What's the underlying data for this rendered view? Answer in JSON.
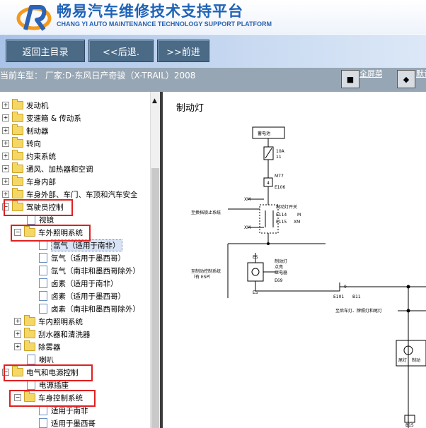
{
  "header": {
    "title": "畅易汽车维修技术支持平台",
    "subtitle": "CHANG YI AUTO MAINTENANCE TECHNOLOGY SUPPORT PLATFORM"
  },
  "toolbar": {
    "home_label": "返回主目录",
    "back_label": "<<后退.",
    "forward_label": ">>前进"
  },
  "infobar": {
    "model_text": "当前车型：  厂家:D-东风日产奇骏（X-TRAIL）2008",
    "fullscreen_label": "全屏菜单",
    "default_label": "默认视图"
  },
  "tree": {
    "items": [
      {
        "label": "发动机"
      },
      {
        "label": "变速箱 & 传动系"
      },
      {
        "label": "制动器"
      },
      {
        "label": "转向"
      },
      {
        "label": "约束系统"
      },
      {
        "label": "通风、加热器和空调"
      },
      {
        "label": "车身内部"
      },
      {
        "label": "车身外部、车门、车顶和汽车安全"
      },
      {
        "label": "驾驶员控制"
      },
      {
        "label": "视镜"
      },
      {
        "label": "车外照明系统"
      },
      {
        "label": "氙气（适用于南非）"
      },
      {
        "label": "氙气（适用于墨西哥）"
      },
      {
        "label": "氙气（南非和墨西哥除外）"
      },
      {
        "label": "卤素（适用于南非）"
      },
      {
        "label": "卤素（适用于墨西哥）"
      },
      {
        "label": "卤素（南非和墨西哥除外）"
      },
      {
        "label": "车内照明系统"
      },
      {
        "label": "刮水器和清洗器"
      },
      {
        "label": "除雾器"
      },
      {
        "label": "喇叭"
      },
      {
        "label": "电气和电源控制"
      },
      {
        "label": "电源插座"
      },
      {
        "label": "车身控制系统"
      },
      {
        "label": "适用于南非"
      },
      {
        "label": "适用于墨西哥"
      }
    ]
  },
  "diagram": {
    "title": "制动灯",
    "labels": {
      "battery": "蓄电池",
      "fuse_amp": "10A",
      "fuse_no": "11",
      "conn_m77": "M77",
      "conn_e106": "E106",
      "pin4": "4",
      "xm": "XM",
      "es": "ES",
      "m": "M",
      "switch_name": "制动灯开关",
      "conn_e114": "E114",
      "conn_e115": "E115",
      "dual_system": "至换档锁止系统",
      "brake_ctrl_1": "至制动控制系统",
      "brake_ctrl_2": "（有 ESP）",
      "relay_1": "制动灯",
      "relay_2": "点亮",
      "relay_3": "继电器",
      "conn_e69": "E69",
      "conn_e101": "E101",
      "conn_b11": "B11",
      "pin9": "9",
      "to_tail": "至后车灯、牌照灯和尾灯",
      "tail": "尾灯",
      "brake": "制动",
      "conn_b15": "B15"
    }
  }
}
